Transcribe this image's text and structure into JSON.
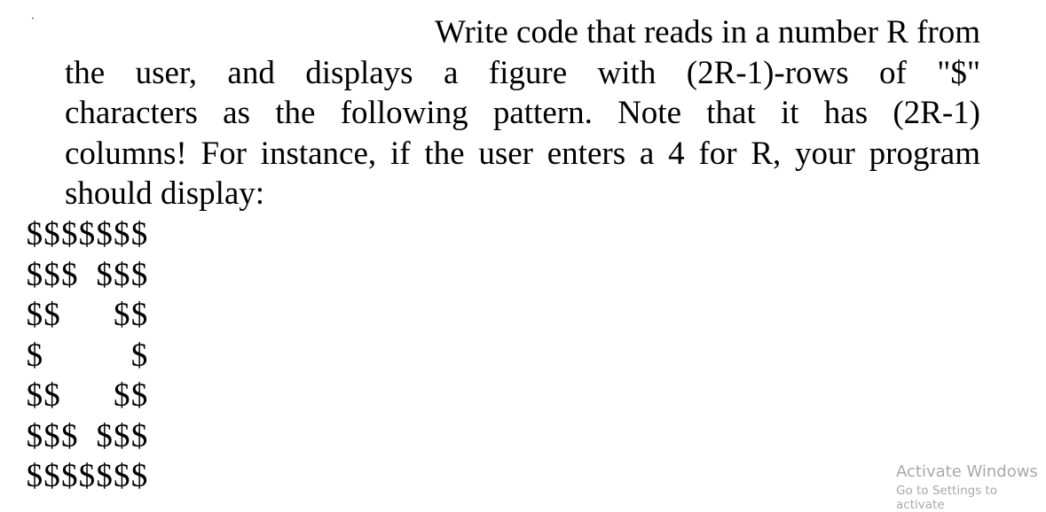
{
  "document": {
    "paragraph_lines": [
      "Write code that reads in a number R from",
      "the user, and displays a figure with (2R-1)-rows of \"$\"",
      "characters as the following pattern. Note that it has (2R-1)",
      "columns! For instance, if the user enters a 4 for R, your program",
      "should display:"
    ],
    "pattern_rows": [
      "$$$$$$$",
      "$$$ $$$",
      "$$   $$",
      "$     $",
      "$$   $$",
      "$$$ $$$",
      "$$$$$$$"
    ]
  },
  "watermark": {
    "title": "Activate Windows",
    "subtitle": "Go to Settings to activate"
  }
}
